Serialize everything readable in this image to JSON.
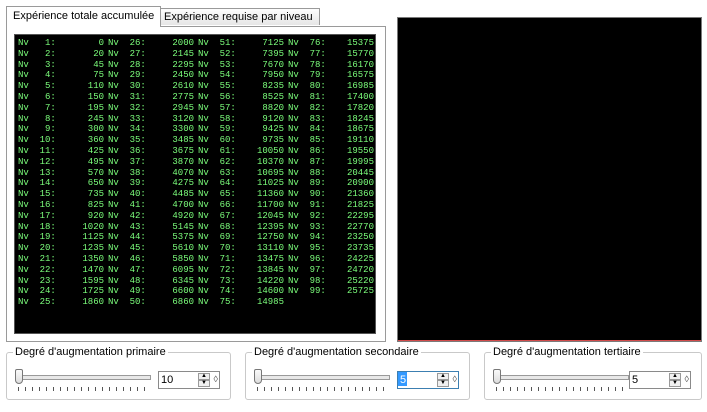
{
  "tabs": [
    {
      "label": "Expérience totale accumulée",
      "active": true
    },
    {
      "label": "Expérience requise par niveau",
      "active": false
    }
  ],
  "level_prefix": "Nv",
  "levels": [
    [
      1,
      0
    ],
    [
      2,
      20
    ],
    [
      3,
      45
    ],
    [
      4,
      75
    ],
    [
      5,
      110
    ],
    [
      6,
      150
    ],
    [
      7,
      195
    ],
    [
      8,
      245
    ],
    [
      9,
      300
    ],
    [
      10,
      360
    ],
    [
      11,
      425
    ],
    [
      12,
      495
    ],
    [
      13,
      570
    ],
    [
      14,
      650
    ],
    [
      15,
      735
    ],
    [
      16,
      825
    ],
    [
      17,
      920
    ],
    [
      18,
      1020
    ],
    [
      19,
      1125
    ],
    [
      20,
      1235
    ],
    [
      21,
      1350
    ],
    [
      22,
      1470
    ],
    [
      23,
      1595
    ],
    [
      24,
      1725
    ],
    [
      25,
      1860
    ],
    [
      26,
      2000
    ],
    [
      27,
      2145
    ],
    [
      28,
      2295
    ],
    [
      29,
      2450
    ],
    [
      30,
      2610
    ],
    [
      31,
      2775
    ],
    [
      32,
      2945
    ],
    [
      33,
      3120
    ],
    [
      34,
      3300
    ],
    [
      35,
      3485
    ],
    [
      36,
      3675
    ],
    [
      37,
      3870
    ],
    [
      38,
      4070
    ],
    [
      39,
      4275
    ],
    [
      40,
      4485
    ],
    [
      41,
      4700
    ],
    [
      42,
      4920
    ],
    [
      43,
      5145
    ],
    [
      44,
      5375
    ],
    [
      45,
      5610
    ],
    [
      46,
      5850
    ],
    [
      47,
      6095
    ],
    [
      48,
      6345
    ],
    [
      49,
      6600
    ],
    [
      50,
      6860
    ],
    [
      51,
      7125
    ],
    [
      52,
      7395
    ],
    [
      53,
      7670
    ],
    [
      54,
      7950
    ],
    [
      55,
      8235
    ],
    [
      56,
      8525
    ],
    [
      57,
      8820
    ],
    [
      58,
      9120
    ],
    [
      59,
      9425
    ],
    [
      60,
      9735
    ],
    [
      61,
      10050
    ],
    [
      62,
      10370
    ],
    [
      63,
      10695
    ],
    [
      64,
      11025
    ],
    [
      65,
      11360
    ],
    [
      66,
      11700
    ],
    [
      67,
      12045
    ],
    [
      68,
      12395
    ],
    [
      69,
      12750
    ],
    [
      70,
      13110
    ],
    [
      71,
      13475
    ],
    [
      72,
      13845
    ],
    [
      73,
      14220
    ],
    [
      74,
      14600
    ],
    [
      75,
      14985
    ],
    [
      76,
      15375
    ],
    [
      77,
      15770
    ],
    [
      78,
      16170
    ],
    [
      79,
      16575
    ],
    [
      80,
      16985
    ],
    [
      81,
      17400
    ],
    [
      82,
      17820
    ],
    [
      83,
      18245
    ],
    [
      84,
      18675
    ],
    [
      85,
      19110
    ],
    [
      86,
      19550
    ],
    [
      87,
      19995
    ],
    [
      88,
      20445
    ],
    [
      89,
      20900
    ],
    [
      90,
      21360
    ],
    [
      91,
      21825
    ],
    [
      92,
      22295
    ],
    [
      93,
      22770
    ],
    [
      94,
      23250
    ],
    [
      95,
      23735
    ],
    [
      96,
      24225
    ],
    [
      97,
      24720
    ],
    [
      98,
      25220
    ],
    [
      99,
      25725
    ]
  ],
  "controls": {
    "primary": {
      "legend": "Degré d'augmentation primaire",
      "value": "10",
      "slider": 0.0
    },
    "secondary": {
      "legend": "Degré d'augmentation secondaire",
      "value": "5",
      "slider": 0.0
    },
    "tertiary": {
      "legend": "Degré d'augmentation tertiaire",
      "value": "5",
      "slider": 0.0
    }
  },
  "icons": {
    "spin_up": "up-arrow-icon",
    "spin_down": "down-arrow-icon",
    "spin_extra": "diamond-icon"
  },
  "colors": {
    "console_bg": "#000000",
    "console_text": "#7cff7c",
    "selection": "#3399ff"
  }
}
